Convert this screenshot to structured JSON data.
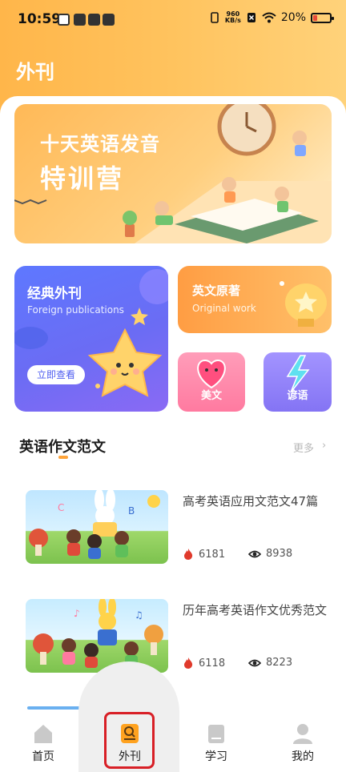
{
  "status_bar": {
    "time": "10:59",
    "net_speed_value": "960",
    "net_speed_unit": "KB/s",
    "battery": "20%"
  },
  "page_title": "外刊",
  "banner": {
    "line1": "十天英语发音",
    "line2": "特训营"
  },
  "cards": {
    "classic": {
      "title": "经典外刊",
      "subtitle": "Foreign publications",
      "cta": "立即查看"
    },
    "original": {
      "title": "英文原著",
      "subtitle": "Original work"
    },
    "prose": {
      "label": "美文"
    },
    "proverb": {
      "label": "谚语"
    }
  },
  "section": {
    "title": "英语作文范文",
    "more": "更多",
    "chevron": "›"
  },
  "articles": [
    {
      "title": "高考英语应用文范文47篇",
      "hot": "6181",
      "views": "8938"
    },
    {
      "title": "历年高考英语作文优秀范文",
      "hot": "6118",
      "views": "8223"
    }
  ],
  "nav": [
    {
      "label": "首页",
      "icon": "home-icon"
    },
    {
      "label": "外刊",
      "icon": "magazine-icon",
      "active": true
    },
    {
      "label": "学习",
      "icon": "book-icon"
    },
    {
      "label": "我的",
      "icon": "person-icon"
    }
  ],
  "colors": {
    "accent": "#ffa43a",
    "highlight": "#d81f26",
    "hot": "#e03a2c"
  }
}
